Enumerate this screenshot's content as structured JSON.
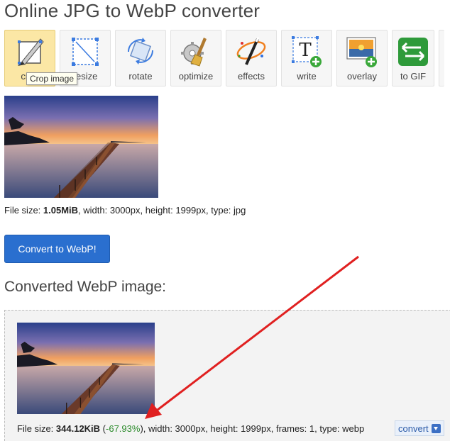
{
  "page": {
    "title": "Online JPG to WebP converter",
    "subtitle": "Converted WebP image:"
  },
  "toolbar": {
    "tools": [
      {
        "label": "crop",
        "icon": "crop-icon",
        "active": true
      },
      {
        "label": "resize",
        "icon": "resize-icon"
      },
      {
        "label": "rotate",
        "icon": "rotate-icon"
      },
      {
        "label": "optimize",
        "icon": "optimize-icon"
      },
      {
        "label": "effects",
        "icon": "effects-icon"
      },
      {
        "label": "write",
        "icon": "write-icon"
      },
      {
        "label": "overlay",
        "icon": "overlay-icon"
      },
      {
        "label": "to GIF",
        "icon": "to-gif-icon"
      }
    ],
    "tooltip": "Crop image"
  },
  "original": {
    "prefix": "File size: ",
    "size": "1.05MiB",
    "details": ", width: 3000px, height: 1999px, type: jpg"
  },
  "convert_button": "Convert to WebP!",
  "converted": {
    "prefix": "File size: ",
    "size": "344.12KiB",
    "open_paren": " (",
    "percent": "-67.93%",
    "details": "), width: 3000px, height: 1999px, frames: 1, type: webp",
    "convert_label": "convert"
  },
  "colors": {
    "primary_button": "#2a6fcf",
    "active_tool": "#fbe7a5",
    "percent_green": "#2a8a2a",
    "annotation_arrow": "#e02020"
  }
}
